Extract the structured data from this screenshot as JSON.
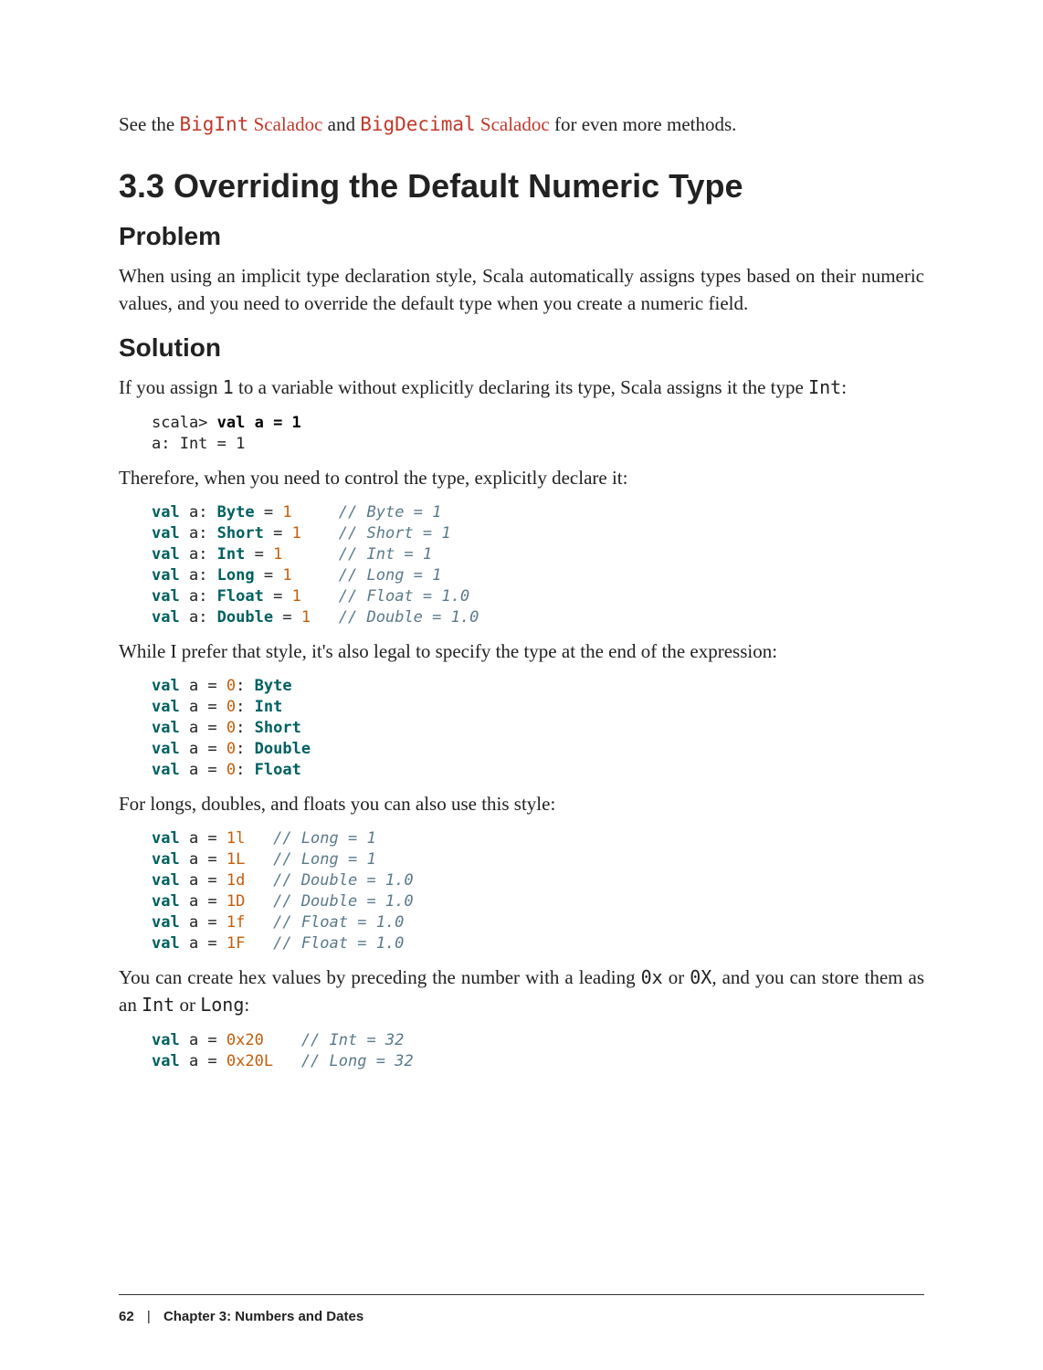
{
  "intro": {
    "before": "See the ",
    "link1_code": "BigInt",
    "link1_text": " Scaladoc",
    "mid": " and ",
    "link2_code": "BigDecimal",
    "link2_text": " Scaladoc",
    "after": " for even more methods."
  },
  "section_title": "3.3 Overriding the Default Numeric Type",
  "problem_heading": "Problem",
  "problem_text": "When using an implicit type declaration style, Scala automatically assigns types based on their numeric values, and you need to override the default type when you create a numeric field.",
  "solution_heading": "Solution",
  "solution_p1_a": "If you assign ",
  "solution_p1_code": "1",
  "solution_p1_b": " to a variable without explicitly declaring its type, Scala assigns it the type ",
  "solution_p1_code2": "Int",
  "solution_p1_c": ":",
  "code_repl": "scala> val a = 1\na: Int = 1",
  "p2": "Therefore, when you need to control the type, explicitly declare it:",
  "code_typedecl": [
    {
      "kw": "val",
      "var": " a: ",
      "typ": "Byte",
      "rest": " = ",
      "num": "1",
      "pad": "     ",
      "cmt": "// Byte = 1"
    },
    {
      "kw": "val",
      "var": " a: ",
      "typ": "Short",
      "rest": " = ",
      "num": "1",
      "pad": "    ",
      "cmt": "// Short = 1"
    },
    {
      "kw": "val",
      "var": " a: ",
      "typ": "Int",
      "rest": " = ",
      "num": "1",
      "pad": "      ",
      "cmt": "// Int = 1"
    },
    {
      "kw": "val",
      "var": " a: ",
      "typ": "Long",
      "rest": " = ",
      "num": "1",
      "pad": "     ",
      "cmt": "// Long = 1"
    },
    {
      "kw": "val",
      "var": " a: ",
      "typ": "Float",
      "rest": " = ",
      "num": "1",
      "pad": "    ",
      "cmt": "// Float = 1.0"
    },
    {
      "kw": "val",
      "var": " a: ",
      "typ": "Double",
      "rest": " = ",
      "num": "1",
      "pad": "   ",
      "cmt": "// Double = 1.0"
    }
  ],
  "p3": "While I prefer that style, it's also legal to specify the type at the end of the expression:",
  "code_suffix_type": [
    {
      "kw": "val",
      "var": " a = ",
      "num": "0",
      "colon": ": ",
      "typ": "Byte"
    },
    {
      "kw": "val",
      "var": " a = ",
      "num": "0",
      "colon": ": ",
      "typ": "Int"
    },
    {
      "kw": "val",
      "var": " a = ",
      "num": "0",
      "colon": ": ",
      "typ": "Short"
    },
    {
      "kw": "val",
      "var": " a = ",
      "num": "0",
      "colon": ": ",
      "typ": "Double"
    },
    {
      "kw": "val",
      "var": " a = ",
      "num": "0",
      "colon": ": ",
      "typ": "Float"
    }
  ],
  "p4": "For longs, doubles, and floats you can also use this style:",
  "code_letter_suffix": [
    {
      "kw": "val",
      "var": " a = ",
      "num": "1l",
      "pad": "   ",
      "cmt": "// Long = 1"
    },
    {
      "kw": "val",
      "var": " a = ",
      "num": "1L",
      "pad": "   ",
      "cmt": "// Long = 1"
    },
    {
      "kw": "val",
      "var": " a = ",
      "num": "1d",
      "pad": "   ",
      "cmt": "// Double = 1.0"
    },
    {
      "kw": "val",
      "var": " a = ",
      "num": "1D",
      "pad": "   ",
      "cmt": "// Double = 1.0"
    },
    {
      "kw": "val",
      "var": " a = ",
      "num": "1f",
      "pad": "   ",
      "cmt": "// Float = 1.0"
    },
    {
      "kw": "val",
      "var": " a = ",
      "num": "1F",
      "pad": "   ",
      "cmt": "// Float = 1.0"
    }
  ],
  "p5_a": "You can create hex values by preceding the number with a leading ",
  "p5_code1": "0x",
  "p5_b": " or ",
  "p5_code2": "0X",
  "p5_c": ", and you can store them as an ",
  "p5_code3": "Int",
  "p5_d": " or ",
  "p5_code4": "Long",
  "p5_e": ":",
  "code_hex": [
    {
      "kw": "val",
      "var": " a = ",
      "num": "0x20",
      "pad": "    ",
      "cmt": "// Int = 32"
    },
    {
      "kw": "val",
      "var": " a = ",
      "num": "0x20L",
      "pad": "   ",
      "cmt": "// Long = 32"
    }
  ],
  "footer": {
    "page_number": "62",
    "separator": "|",
    "chapter": "Chapter 3: Numbers and Dates"
  }
}
